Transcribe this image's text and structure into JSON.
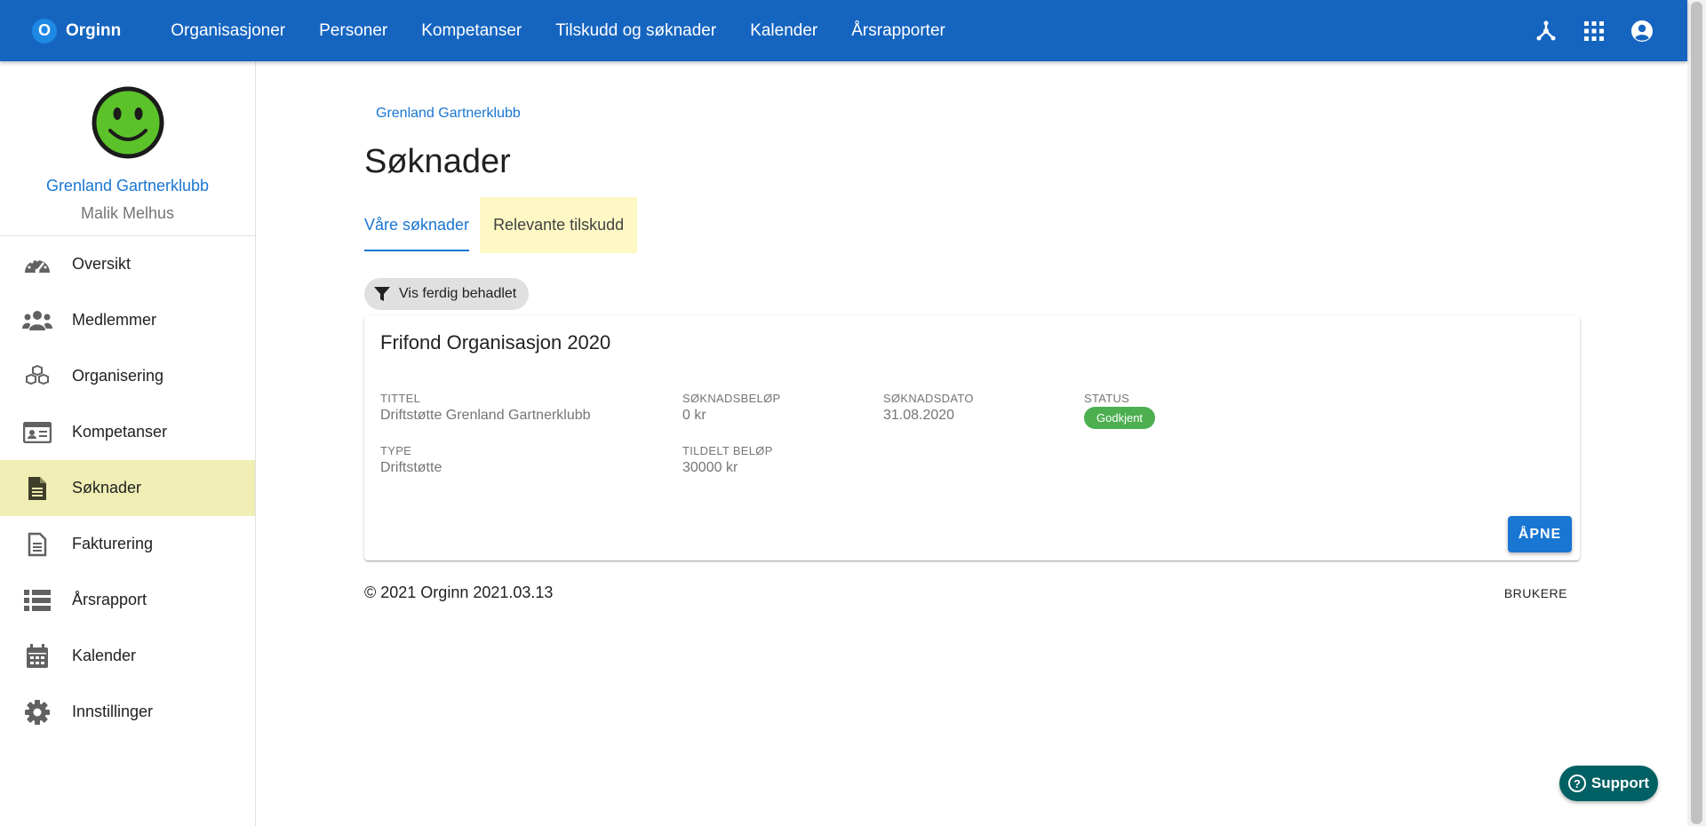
{
  "app": {
    "logo_letter": "O",
    "logo_text": "Orginn"
  },
  "topnav": {
    "items": [
      "Organisasjoner",
      "Personer",
      "Kompetanser",
      "Tilskudd og søknader",
      "Kalender",
      "Årsrapporter"
    ]
  },
  "top_icons": [
    "hierarchy-icon",
    "apps-grid-icon",
    "account-circle-icon"
  ],
  "sidebar": {
    "org_name": "Grenland Gartnerklubb",
    "user_name": "Malik Melhus",
    "items": [
      {
        "label": "Oversikt",
        "icon": "dashboard-icon"
      },
      {
        "label": "Medlemmer",
        "icon": "users-icon"
      },
      {
        "label": "Organisering",
        "icon": "cubes-icon"
      },
      {
        "label": "Kompetanser",
        "icon": "id-card-icon"
      },
      {
        "label": "Søknader",
        "icon": "document-icon",
        "active": true
      },
      {
        "label": "Fakturering",
        "icon": "invoice-icon"
      },
      {
        "label": "Årsrapport",
        "icon": "list-icon"
      },
      {
        "label": "Kalender",
        "icon": "calendar-icon"
      },
      {
        "label": "Innstillinger",
        "icon": "gear-icon"
      }
    ]
  },
  "main": {
    "breadcrumb": "Grenland Gartnerklubb",
    "title": "Søknader",
    "tabs": [
      {
        "label": "Våre søknader",
        "active": true
      },
      {
        "label": "Relevante tilskudd",
        "highlight": true
      }
    ],
    "filter_chip": "Vis ferdig behadlet",
    "card": {
      "title": "Frifond Organisasjon 2020",
      "tittel_label": "TITTEL",
      "tittel_value": "Driftstøtte Grenland Gartnerklubb",
      "soknadsbelop_label": "SØKNADSBELØP",
      "soknadsbelop_value": "0 kr",
      "soknadsdato_label": "SØKNADSDATO",
      "soknadsdato_value": "31.08.2020",
      "status_label": "STATUS",
      "status_value": "Godkjent",
      "type_label": "TYPE",
      "type_value": "Driftstøtte",
      "tildelt_label": "TILDELT BELØP",
      "tildelt_value": "30000 kr",
      "open_button": "ÅPNE"
    },
    "footer_text": "© 2021 Orginn 2021.03.13",
    "footer_link": "BRUKERE"
  },
  "support": {
    "label": "Support"
  },
  "colors": {
    "primary": "#1565c0",
    "accent": "#1976d2",
    "active_menu_bg": "#f0eeb5",
    "highlight_tab_bg": "#fdf8c4",
    "status_green": "#4caf50",
    "support_bg": "#006064",
    "avatar_green": "#5cc22a"
  }
}
